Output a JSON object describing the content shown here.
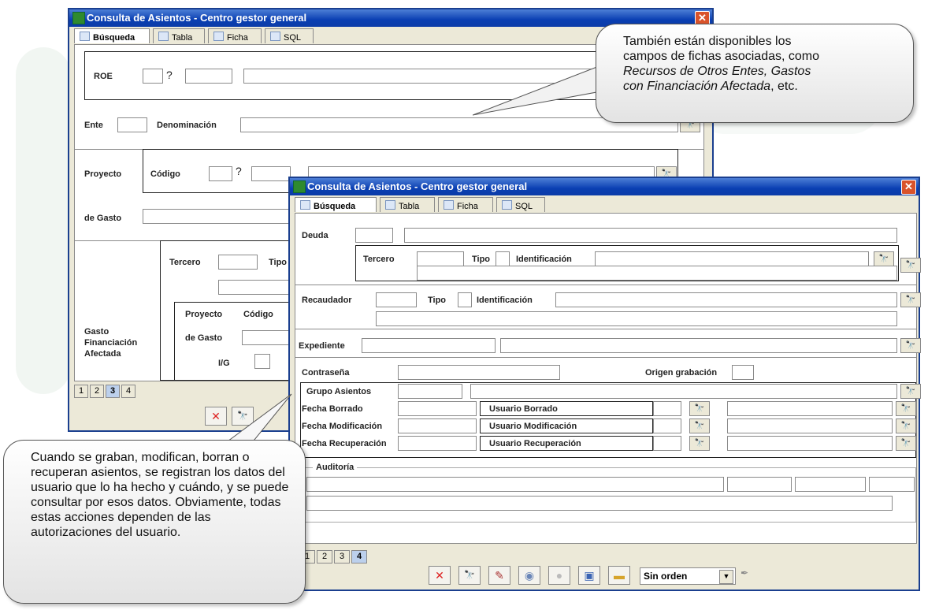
{
  "window_title": "Consulta de Asientos - Centro gestor general",
  "tabs": [
    "Búsqueda",
    "Tabla",
    "Ficha",
    "SQL"
  ],
  "close_glyph": "✕",
  "back": {
    "roe_label": "ROE",
    "qm": "?",
    "ente_label": "Ente",
    "denominacion_label": "Denominación",
    "proyecto_label": "Proyecto",
    "codigo_label": "Código",
    "de_gasto_label": "de Gasto",
    "tercero_label": "Tercero",
    "tipo_label": "Tipo",
    "gasto_label": "Gasto",
    "financiacion_label": "Financiación",
    "afectada_label": "Afectada",
    "proyecto2_label": "Proyecto",
    "codigo2_label": "Código",
    "de_gasto2_label": "de Gasto",
    "ig_label": "I/G",
    "page_tabs": [
      "1",
      "2",
      "3",
      "4"
    ],
    "selected_page": "3"
  },
  "front": {
    "deuda_label": "Deuda",
    "tercero_label": "Tercero",
    "tipo_label": "Tipo",
    "identificacion_label": "Identificación",
    "recaudador_label": "Recaudador",
    "tipo2_label": "Tipo",
    "identificacion2_label": "Identificación",
    "expediente_label": "Expediente",
    "contrasena_label": "Contraseña",
    "origen_label": "Origen grabación",
    "grupo_label": "Grupo Asientos",
    "fecha_borrado_label": "Fecha Borrado",
    "usuario_borrado_label": "Usuario Borrado",
    "fecha_mod_label": "Fecha Modificación",
    "usuario_mod_label": "Usuario Modificación",
    "fecha_rec_label": "Fecha Recuperación",
    "usuario_rec_label": "Usuario Recuperación",
    "auditoria_label": "Auditoría",
    "page_tabs": [
      "1",
      "2",
      "3",
      "4"
    ],
    "selected_page": "4",
    "orden_value": "Sin orden"
  },
  "callout_top": {
    "line1": "También están disponibles los",
    "line2": "campos de fichas asociadas, como",
    "line3_italic": "Recursos de Otros Entes, Gastos",
    "line4_italic": "con Financiación Afectada",
    "line4_rest": ", etc."
  },
  "callout_bottom": {
    "text": "Cuando se graban, modifican, borran o recuperan asientos, se registran los datos del usuario que lo ha hecho y cuándo, y se puede consultar por esos datos. Obviamente, todas estas acciones dependen de las autorizaciones del usuario."
  },
  "icons": {
    "lookup": "binoculars-icon",
    "cancel": "cancel-icon",
    "search": "search-icon",
    "clear": "eraser-icon",
    "save": "save-icon",
    "open": "folder-icon"
  },
  "colors": {
    "title_bar": "#0a3fb2",
    "selected_page_tab": "#bcd0ec",
    "callout_border": "#555555"
  }
}
